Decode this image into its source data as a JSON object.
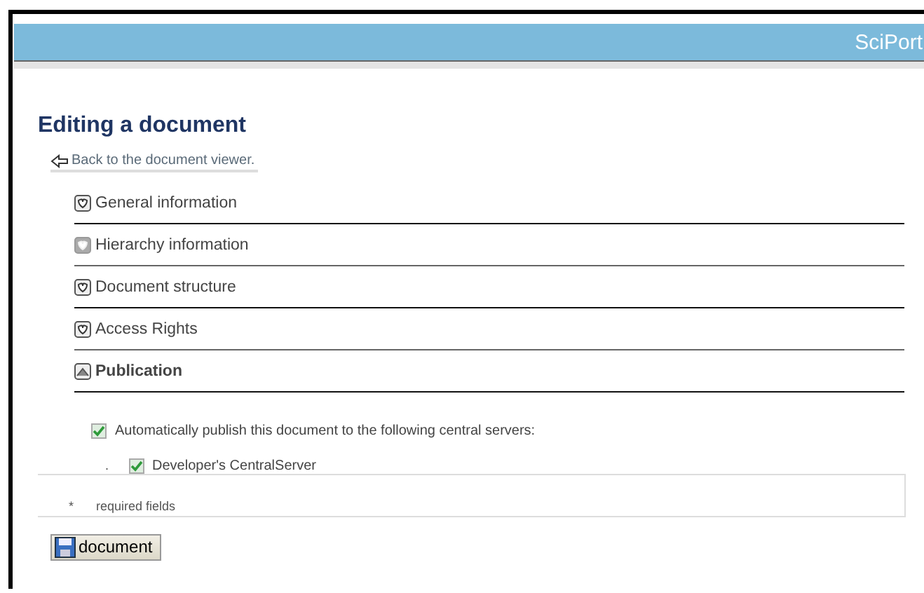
{
  "header": {
    "title": "SciPort"
  },
  "page_title": "Editing a document",
  "back_link": "Back to the document viewer.",
  "sections": [
    {
      "label": "General information",
      "expanded": false,
      "disabled": false
    },
    {
      "label": "Hierarchy information",
      "expanded": false,
      "disabled": true
    },
    {
      "label": "Document structure",
      "expanded": false,
      "disabled": false
    },
    {
      "label": "Access Rights",
      "expanded": false,
      "disabled": false
    },
    {
      "label": "Publication",
      "expanded": true,
      "disabled": false
    }
  ],
  "publish": {
    "label": "Automatically publish this document to the following central servers:",
    "checked": true
  },
  "servers": [
    {
      "marker": ".",
      "label": "Developer's CentralServer",
      "checked": true
    }
  ],
  "required": {
    "marker": "*",
    "label": "required fields"
  },
  "save_button": "document"
}
